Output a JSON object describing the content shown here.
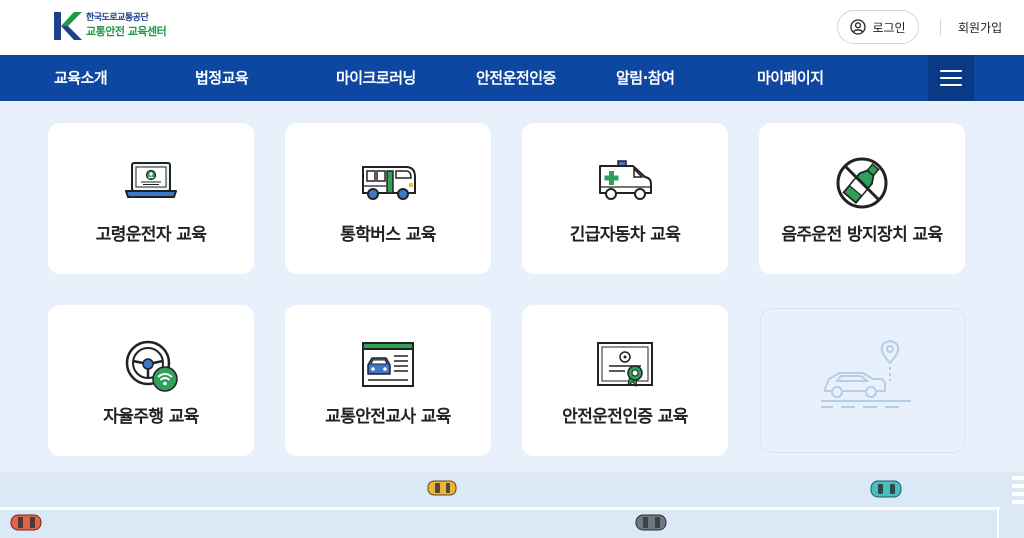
{
  "header": {
    "logo": {
      "org_name": "한국도로교통공단",
      "center_name": "교통안전 교육센터",
      "icon": "kotsa-logo-icon"
    },
    "login_label": "로그인",
    "login_icon": "user-circle-icon",
    "join_label": "회원가입"
  },
  "nav": {
    "items": [
      {
        "label": "교육소개"
      },
      {
        "label": "법정교육"
      },
      {
        "label": "마이크로러닝"
      },
      {
        "label": "안전운전인증"
      },
      {
        "label": "알림·참여"
      },
      {
        "label": "마이페이지"
      }
    ],
    "menu_icon": "hamburger-menu-icon"
  },
  "cards": [
    {
      "label": "고령운전자 교육",
      "icon": "laptop-user-icon"
    },
    {
      "label": "통학버스 교육",
      "icon": "school-bus-icon"
    },
    {
      "label": "긴급자동차 교육",
      "icon": "ambulance-icon"
    },
    {
      "label": "음주운전 방지장치 교육",
      "icon": "no-drinking-icon"
    },
    {
      "label": "자율주행 교육",
      "icon": "steering-wheel-wifi-icon"
    },
    {
      "label": "교통안전교사 교육",
      "icon": "car-poster-icon"
    },
    {
      "label": "안전운전인증 교육",
      "icon": "certificate-icon"
    }
  ],
  "decor": {
    "ghost_icon": "car-location-pin-icon",
    "road_cars": [
      "yellow-car-icon",
      "teal-car-icon",
      "red-car-icon",
      "gray-car-icon"
    ]
  },
  "colors": {
    "nav_bg": "#0d47a1",
    "page_bg": "#e8f1fb",
    "accent_green": "#1b9a49",
    "brand_blue": "#1f3f8a"
  }
}
